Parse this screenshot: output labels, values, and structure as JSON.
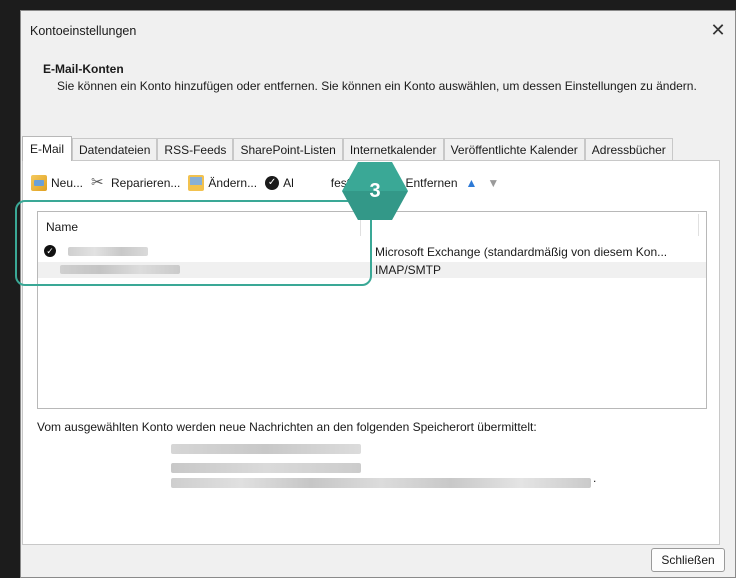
{
  "window": {
    "title": "Kontoeinstellungen",
    "close_glyph": "✕"
  },
  "header": {
    "title": "E-Mail-Konten",
    "description": "Sie können ein Konto hinzufügen oder entfernen. Sie können ein Konto auswählen, um dessen Einstellungen zu ändern."
  },
  "tabs": [
    {
      "label": "E-Mail",
      "active": true
    },
    {
      "label": "Datendateien"
    },
    {
      "label": "RSS-Feeds"
    },
    {
      "label": "SharePoint-Listen"
    },
    {
      "label": "Internetkalender"
    },
    {
      "label": "Veröffentlichte Kalender"
    },
    {
      "label": "Adressbücher"
    }
  ],
  "toolbar": {
    "new_label": "Neu...",
    "repair_label": "Reparieren...",
    "change_label": "Ändern...",
    "default_label_visible": "Al",
    "default_label_tail": "festlegen",
    "remove_label": "Entfernen"
  },
  "accounts": {
    "column_name": "Name",
    "rows": [
      {
        "type": "Microsoft Exchange (standardmäßig von diesem Kon...",
        "default": true
      },
      {
        "type": "IMAP/SMTP",
        "default": false
      }
    ]
  },
  "delivery": {
    "text": "Vom ausgewählten Konto werden neue Nachrichten an den folgenden Speicherort übermittelt:",
    "trailing_dot": "."
  },
  "footer": {
    "close_label": "Schließen"
  },
  "annotation": {
    "step_number": "3",
    "color": "#3aa896"
  }
}
